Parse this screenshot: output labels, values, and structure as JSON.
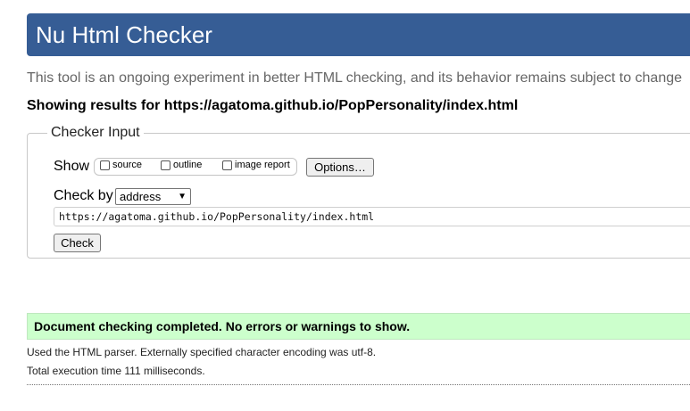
{
  "header": {
    "title": "Nu Html Checker"
  },
  "intro": "This tool is an ongoing experiment in better HTML checking, and its behavior remains subject to change",
  "results_heading": "Showing results for https://agatoma.github.io/PopPersonality/index.html",
  "checker_input": {
    "legend": "Checker Input",
    "show_label": "Show",
    "show_options": [
      {
        "label": "source",
        "checked": false
      },
      {
        "label": "outline",
        "checked": false
      },
      {
        "label": "image report",
        "checked": false
      }
    ],
    "options_button": "Options…",
    "check_by_label": "Check by",
    "check_by_value": "address",
    "url_value": "https://agatoma.github.io/PopPersonality/index.html",
    "check_button": "Check"
  },
  "result": {
    "message": "Document checking completed. No errors or warnings to show.",
    "parser_info": "Used the HTML parser. Externally specified character encoding was utf-8.",
    "timing": "Total execution time 111 milliseconds."
  },
  "colors": {
    "banner": "#365d95",
    "success_bg": "#ccffcc"
  }
}
